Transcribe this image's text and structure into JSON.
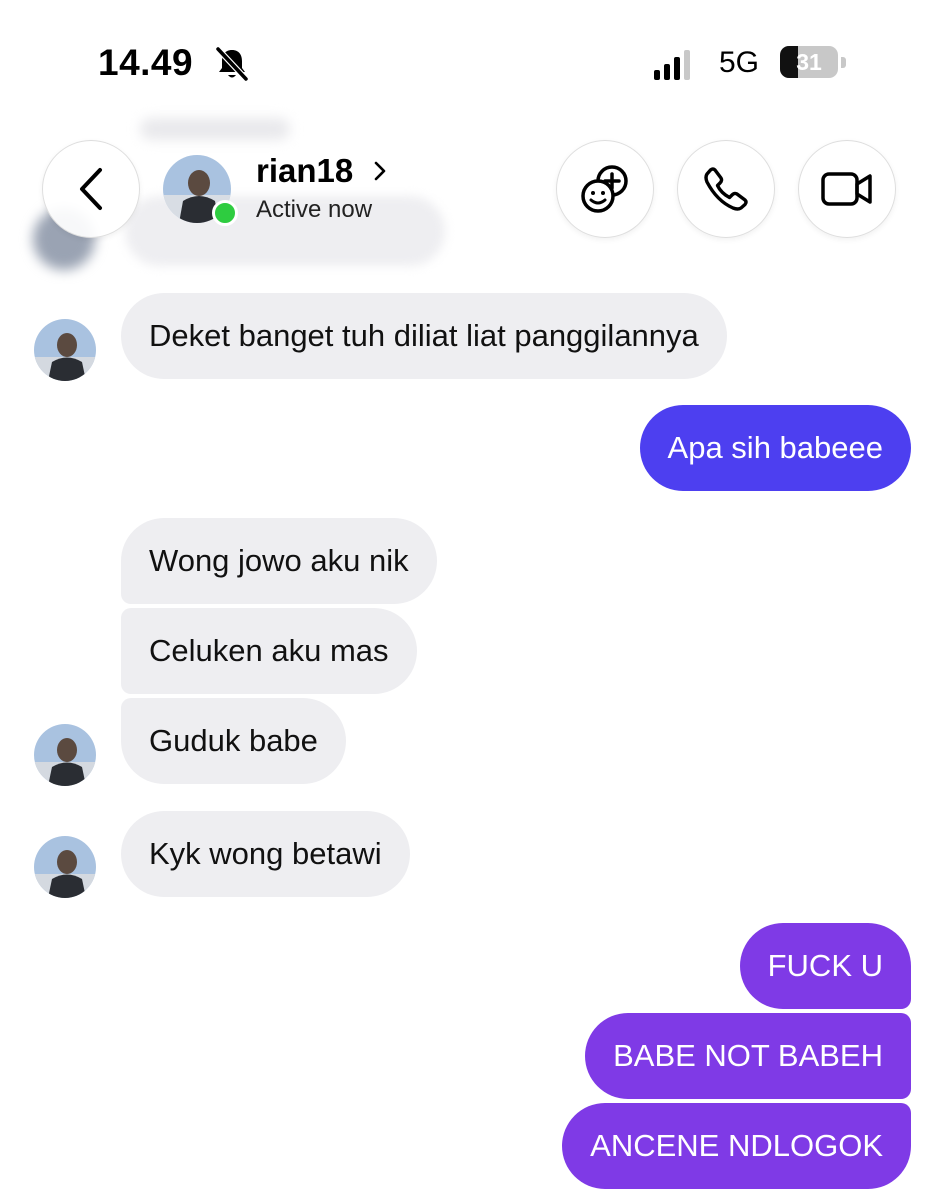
{
  "status_bar": {
    "time": "14.49",
    "silent_icon": "bell-slash-icon",
    "signal_icon": "cellular-signal-icon",
    "network": "5G",
    "battery": "31",
    "battery_level": 0.31
  },
  "header": {
    "back_icon": "chevron-left-icon",
    "username": "rian18",
    "chevron_icon": "chevron-right-icon",
    "status": "Active now",
    "status_color": "#2ecc40",
    "actions": [
      {
        "icon": "games-icon"
      },
      {
        "icon": "phone-icon"
      },
      {
        "icon": "video-camera-icon"
      }
    ]
  },
  "messages": [
    {
      "side": "in",
      "text": "Deket banget tuh diliat liat panggilannya"
    },
    {
      "side": "out",
      "text": "Apa sih babeee"
    },
    {
      "side": "in",
      "text": "Wong jowo aku nik"
    },
    {
      "side": "in",
      "text": "Celuken aku mas"
    },
    {
      "side": "in",
      "text": "Guduk babe"
    },
    {
      "side": "in",
      "text": "Kyk wong betawi"
    },
    {
      "side": "out",
      "text": "FUCK U"
    },
    {
      "side": "out",
      "text": "BABE NOT BABEH"
    },
    {
      "side": "out",
      "text": "ANCENE NDLOGOK"
    }
  ],
  "colors": {
    "incoming_bubble": "#eeeef1",
    "outgoing_blue": "#4d3ff0",
    "outgoing_purple": "#7f3ae6"
  }
}
